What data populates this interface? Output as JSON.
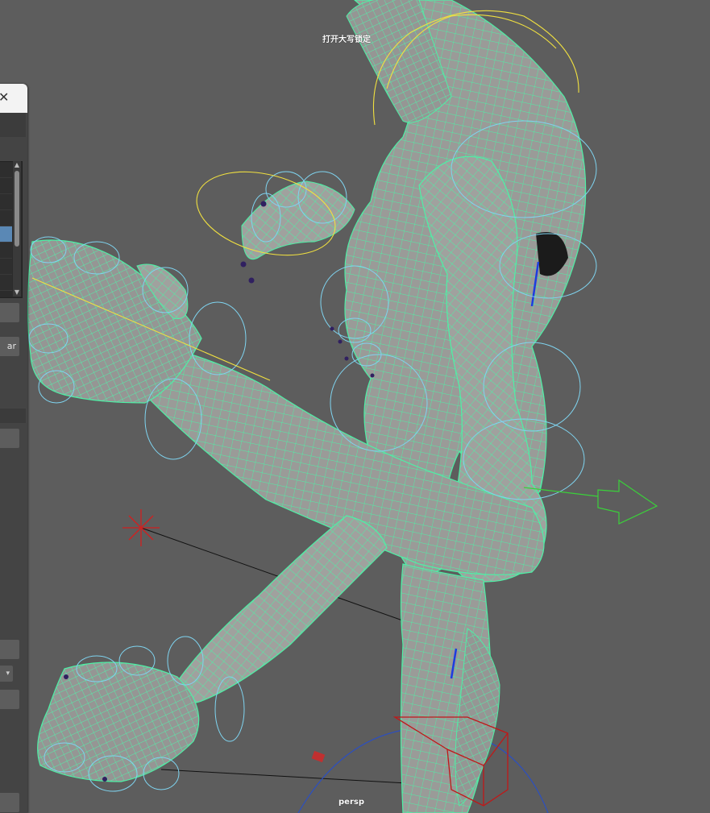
{
  "viewport": {
    "hud_message": "打开大写锁定",
    "camera": "persp",
    "background": "#5d5d5d",
    "wire_color": "#4ef0a6",
    "mesh_fill": "#999a97",
    "control_curve_color": "#7fd4f0",
    "selected_curve_color": "#f0e040"
  },
  "panel": {
    "close_icon": "close-icon",
    "button_partial_label": "ar",
    "selected_row_color": "#5a88b5"
  },
  "icons": {
    "move_manipulator": "green-arrow-manipulator-icon",
    "light": "red-directional-light-icon",
    "root_control": "red-cube-control-icon"
  }
}
